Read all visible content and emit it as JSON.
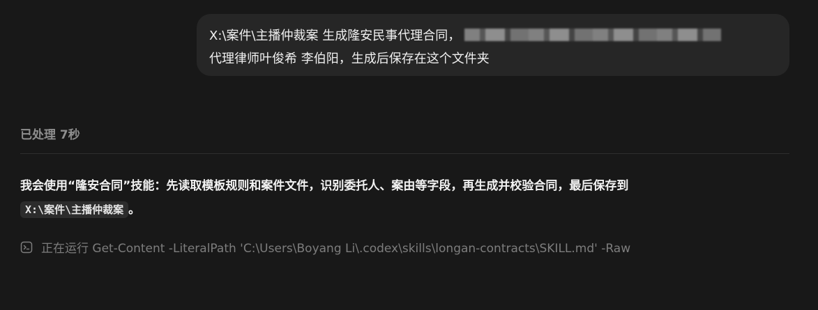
{
  "user_message": {
    "line1": "X:\\案件\\主播仲裁案 生成隆安民事代理合同，",
    "line2": "代理律师叶俊希 李伯阳，生成后保存在这个文件夹"
  },
  "status": {
    "processed_label": "已处理 7秒"
  },
  "assistant": {
    "line1": "我会使用“隆安合同”技能：先读取模板规则和案件文件，识别委托人、案由等字段，再生成并校验合同，最后保存到",
    "path_code": "X:\\案件\\主播仲裁案",
    "line2_suffix": "。"
  },
  "running": {
    "icon": "terminal-icon",
    "text": "正在运行 Get-Content -LiteralPath 'C:\\Users\\Boyang Li\\.codex\\skills\\longan-contracts\\SKILL.md' -Raw"
  }
}
